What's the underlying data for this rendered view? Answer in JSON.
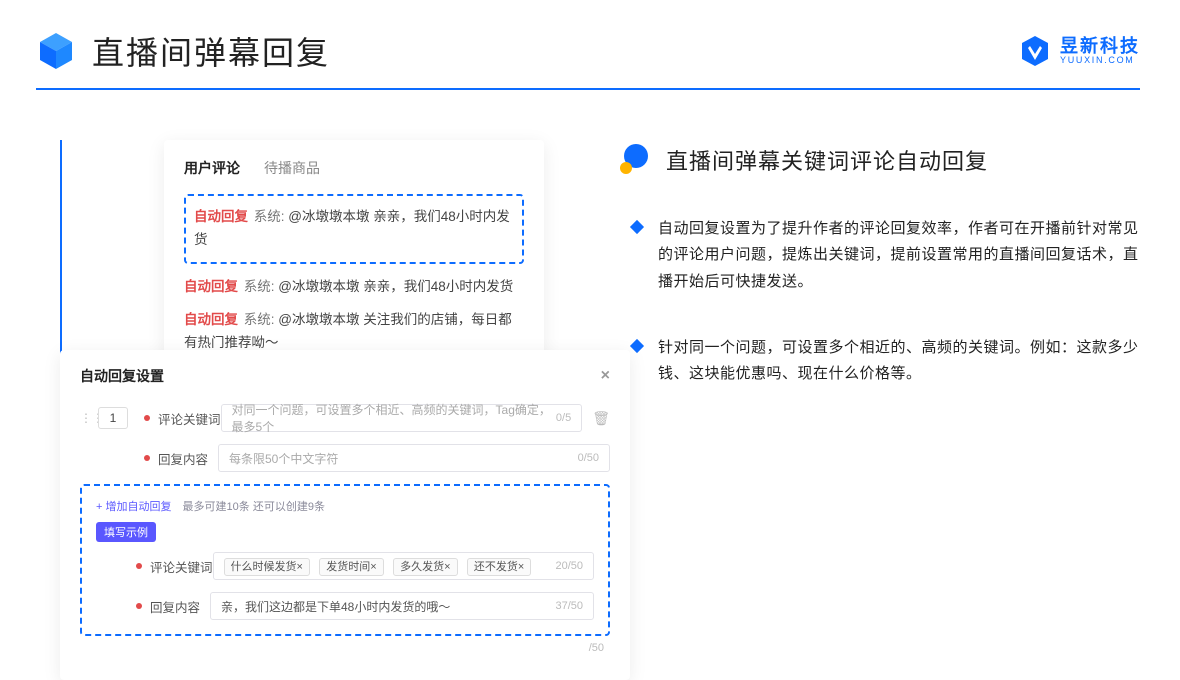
{
  "header": {
    "title": "直播间弹幕回复",
    "brand_cn": "昱新科技",
    "brand_en": "YUUXIN.COM"
  },
  "right": {
    "heading": "直播间弹幕关键词评论自动回复",
    "bullets": [
      "自动回复设置为了提升作者的评论回复效率，作者可在开播前针对常见的评论用户问题，提炼出关键词，提前设置常用的直播间回复话术，直播开始后可快捷发送。",
      "针对同一个问题，可设置多个相近的、高频的关键词。例如：这款多少钱、这块能优惠吗、现在什么价格等。"
    ]
  },
  "card1": {
    "tabs": [
      "用户评论",
      "待播商品"
    ],
    "lines": [
      {
        "tag": "自动回复",
        "sys": "系统:",
        "text": " @冰墩墩本墩 亲亲，我们48小时内发货"
      },
      {
        "tag": "自动回复",
        "sys": "系统:",
        "text": " @冰墩墩本墩 亲亲，我们48小时内发货"
      },
      {
        "tag": "自动回复",
        "sys": "系统:",
        "text": " @冰墩墩本墩 关注我们的店铺，每日都有热门推荐呦～"
      }
    ]
  },
  "card2": {
    "title": "自动回复设置",
    "index": "1",
    "row1_label": "评论关键词",
    "row1_placeholder": "对同一个问题，可设置多个相近、高频的关键词，Tag确定，最多5个",
    "row1_count": "0/5",
    "row2_label": "回复内容",
    "row2_placeholder": "每条限50个中文字符",
    "row2_count": "0/50",
    "hint_link": "+ 增加自动回复",
    "hint_text": "最多可建10条 还可以创建9条",
    "badge": "填写示例",
    "ex_kw_label": "评论关键词",
    "ex_kw_tags": [
      "什么时候发货×",
      "发货时间×",
      "多久发货×",
      "还不发货×"
    ],
    "ex_kw_count": "20/50",
    "ex_rc_label": "回复内容",
    "ex_rc_text": "亲，我们这边都是下单48小时内发货的哦～",
    "ex_rc_count": "37/50",
    "outer_count": "/50"
  }
}
